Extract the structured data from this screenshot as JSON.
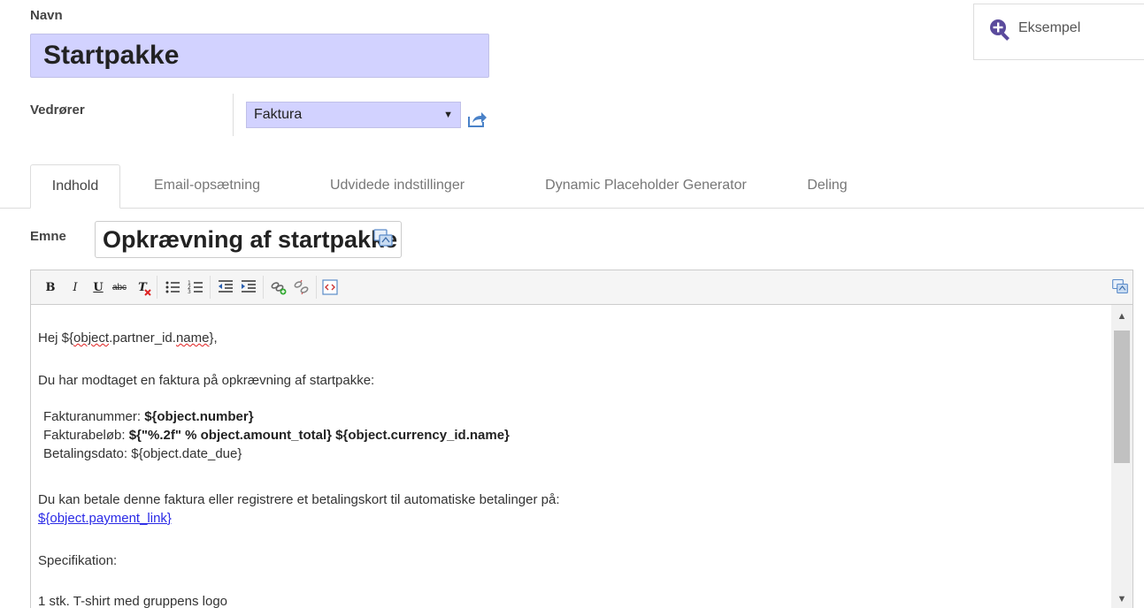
{
  "form": {
    "name_label": "Navn",
    "name_value": "Startpakke",
    "related_label": "Vedrører",
    "related_value": "Faktura",
    "preview_label": "Eksempel"
  },
  "tabs": [
    {
      "label": "Indhold",
      "active": true
    },
    {
      "label": "Email-opsætning",
      "active": false
    },
    {
      "label": "Udvidede indstillinger",
      "active": false
    },
    {
      "label": "Dynamic Placeholder Generator",
      "active": false
    },
    {
      "label": "Deling",
      "active": false
    }
  ],
  "subject": {
    "label": "Emne",
    "value": "Opkrævning af startpakke"
  },
  "toolbar": {
    "bold": "B",
    "italic": "I",
    "underline": "U",
    "strike": "abc",
    "clear_format": "T"
  },
  "body": {
    "greeting_prefix": "Hej ${",
    "greeting_obj": "object",
    "greeting_mid": ".partner_id.",
    "greeting_name": "name",
    "greeting_suffix": "},",
    "intro": "Du har modtaget en faktura på opkrævning af startpakke:",
    "invoice_number_label": "Fakturanummer: ",
    "invoice_number_value": "${object.number}",
    "invoice_amount_label": "Fakturabeløb: ",
    "invoice_amount_value": "${\"%.2f\" % object.amount_total} ${object.currency_id.name}",
    "due_date_label": "Betalingsdato: ",
    "due_date_value": "${object.date_due}",
    "payment_text": "Du kan betale denne faktura eller registrere et betalingskort til automatiske betalinger på:",
    "payment_link": "${object.payment_link}",
    "spec_label": "Specifikation:",
    "spec_line": "1 stk. T-shirt med gruppens logo"
  },
  "colors": {
    "input_highlight": "#d2d2ff",
    "link": "#2a2ae6",
    "accent_icon": "#5a4a9c"
  }
}
